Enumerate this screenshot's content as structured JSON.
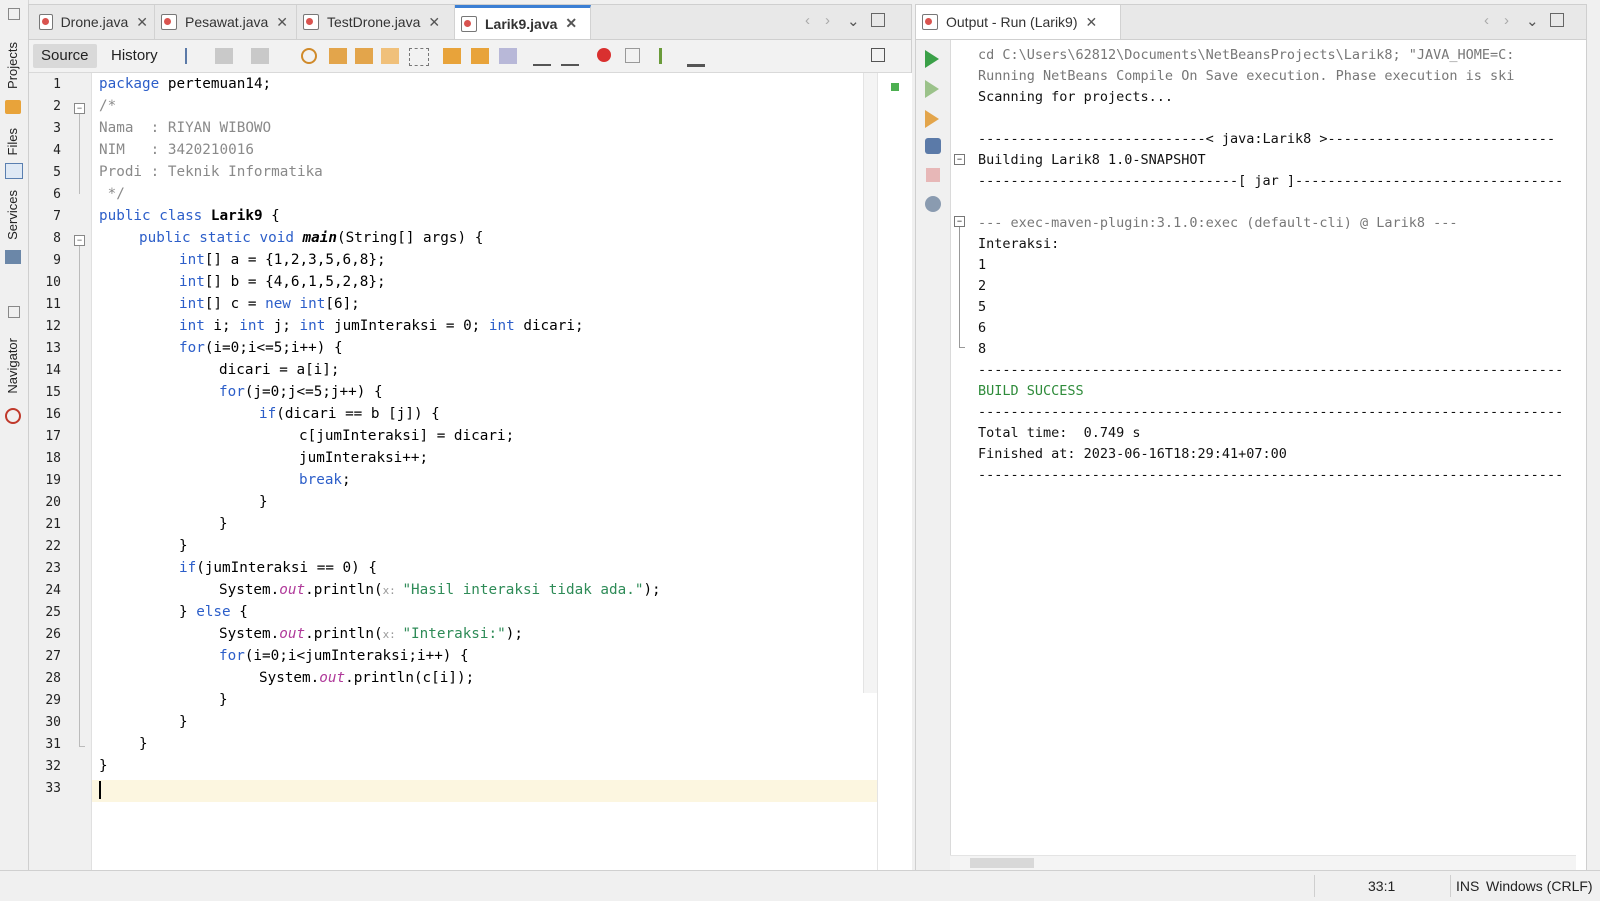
{
  "left_strip": {
    "projects_label": "Projects",
    "files_label": "Files",
    "services_label": "Services",
    "navigator_label": "Navigator"
  },
  "editor": {
    "tabs": [
      {
        "label": "Drone.java"
      },
      {
        "label": "Pesawat.java"
      },
      {
        "label": "TestDrone.java"
      },
      {
        "label": "Larik9.java",
        "active": true
      }
    ],
    "toolbar": {
      "source_label": "Source",
      "history_label": "History"
    },
    "line_numbers": [
      "1",
      "2",
      "3",
      "4",
      "5",
      "6",
      "7",
      "8",
      "9",
      "10",
      "11",
      "12",
      "13",
      "14",
      "15",
      "16",
      "17",
      "18",
      "19",
      "20",
      "21",
      "22",
      "23",
      "24",
      "25",
      "26",
      "27",
      "28",
      "29",
      "30",
      "31",
      "32",
      "33"
    ],
    "code": {
      "l1_kw": "package",
      "l1_rest": " pertemuan14;",
      "l2": "/*",
      "l3": "Nama  : RIYAN WIBOWO",
      "l4": "NIM   : 3420210016",
      "l5": "Prodi : Teknik Informatika",
      "l6": " */",
      "l7_kw": "public class",
      "l7_name": "Larik9",
      "l7_rest": " {",
      "l8_kw": "public static void",
      "l8_name": "main",
      "l8_rest": "(String[] args) {",
      "l9_kw": "int",
      "l9_rest": "[] a = {1,2,3,5,6,8};",
      "l10_kw": "int",
      "l10_rest": "[] b = {4,6,1,5,2,8};",
      "l11_kw": "int",
      "l11_mid": "[] c = ",
      "l11_kw2": "new int",
      "l11_rest": "[6];",
      "l12_kw": "int",
      "l12_a": " i; ",
      "l12_kw2": "int",
      "l12_b": " j; ",
      "l12_kw3": "int",
      "l12_c": " jumInteraksi = 0; ",
      "l12_kw4": "int",
      "l12_d": " dicari;",
      "l13_kw": "for",
      "l13_rest": "(i=0;i<=5;i++) {",
      "l14": "dicari = a[i];",
      "l15_kw": "for",
      "l15_rest": "(j=0;j<=5;j++) {",
      "l16_kw": "if",
      "l16_rest": "(dicari == b [j]) {",
      "l17": "c[jumInteraksi] = dicari;",
      "l18": "jumInteraksi++;",
      "l19_kw": "break",
      "l19_rest": ";",
      "l20": "}",
      "l21": "}",
      "l22": "}",
      "l23_kw": "if",
      "l23_rest": "(jumInteraksi == 0) {",
      "l24_a": "System.",
      "l24_out": "out",
      "l24_b": ".println(",
      "l24_hint": "x: ",
      "l24_str": "\"Hasil interaksi tidak ada.\"",
      "l24_c": ");",
      "l25_a": "} ",
      "l25_kw": "else",
      "l25_b": " {",
      "l26_a": "System.",
      "l26_out": "out",
      "l26_b": ".println(",
      "l26_hint": "x: ",
      "l26_str": "\"Interaksi:\"",
      "l26_c": ");",
      "l27_kw": "for",
      "l27_rest": "(i=0;i<jumInteraksi;i++) {",
      "l28_a": "System.",
      "l28_out": "out",
      "l28_b": ".println(c[i]);",
      "l29": "}",
      "l30": "}",
      "l31": "}",
      "l32": "}"
    }
  },
  "output": {
    "tab_label": "Output - Run (Larik9)",
    "lines": [
      "cd C:\\Users\\62812\\Documents\\NetBeansProjects\\Larik8; \"JAVA_HOME=C:",
      "Running NetBeans Compile On Save execution. Phase execution is ski",
      "Scanning for projects...",
      "",
      "----------------------------< java:Larik8 >----------------------------",
      "Building Larik8 1.0-SNAPSHOT",
      "--------------------------------[ jar ]---------------------------------",
      "",
      "--- exec-maven-plugin:3.1.0:exec (default-cli) @ Larik8 ---",
      "Interaksi:",
      "1",
      "2",
      "5",
      "6",
      "8",
      "------------------------------------------------------------------------",
      "BUILD SUCCESS",
      "------------------------------------------------------------------------",
      "Total time:  0.749 s",
      "Finished at: 2023-06-16T18:29:41+07:00",
      "------------------------------------------------------------------------"
    ]
  },
  "status": {
    "position": "33:1",
    "mode": "INS",
    "line_ending": "Windows (CRLF)"
  }
}
